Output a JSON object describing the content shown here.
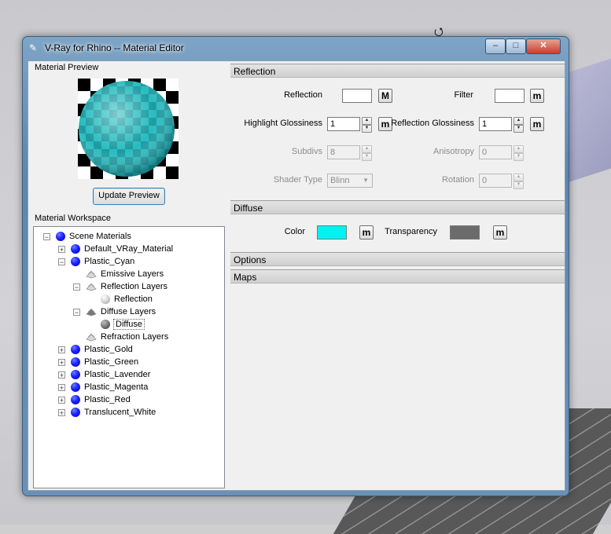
{
  "window": {
    "title": "V-Ray for Rhino -- Material Editor"
  },
  "left": {
    "preview_label": "Material Preview",
    "update_button": "Update Preview",
    "workspace_label": "Material Workspace",
    "tree": [
      {
        "label": "Scene Materials",
        "level": 0,
        "expander": "−",
        "icon": "blue-ball"
      },
      {
        "label": "Default_VRay_Material",
        "level": 1,
        "expander": "+",
        "icon": "blue-ball"
      },
      {
        "label": "Plastic_Cyan",
        "level": 1,
        "expander": "−",
        "icon": "blue-ball"
      },
      {
        "label": "Emissive Layers",
        "level": 2,
        "expander": "",
        "icon": "layer-empty"
      },
      {
        "label": "Reflection Layers",
        "level": 2,
        "expander": "−",
        "icon": "layer-empty"
      },
      {
        "label": "Reflection",
        "level": 3,
        "expander": "",
        "icon": "grey-ball"
      },
      {
        "label": "Diffuse Layers",
        "level": 2,
        "expander": "−",
        "icon": "layer-filled"
      },
      {
        "label": "Diffuse",
        "level": 3,
        "expander": "",
        "icon": "dark-ball",
        "selected": true
      },
      {
        "label": "Refraction Layers",
        "level": 2,
        "expander": "",
        "icon": "layer-empty"
      },
      {
        "label": "Plastic_Gold",
        "level": 1,
        "expander": "+",
        "icon": "blue-ball"
      },
      {
        "label": "Plastic_Green",
        "level": 1,
        "expander": "+",
        "icon": "blue-ball"
      },
      {
        "label": "Plastic_Lavender",
        "level": 1,
        "expander": "+",
        "icon": "blue-ball"
      },
      {
        "label": "Plastic_Magenta",
        "level": 1,
        "expander": "+",
        "icon": "blue-ball"
      },
      {
        "label": "Plastic_Red",
        "level": 1,
        "expander": "+",
        "icon": "blue-ball"
      },
      {
        "label": "Translucent_White",
        "level": 1,
        "expander": "+",
        "icon": "blue-ball"
      }
    ]
  },
  "reflection": {
    "header": "Reflection",
    "reflection_label": "Reflection",
    "filter_label": "Filter",
    "M_btn": "M",
    "m_btn": "m",
    "hl_gloss_label": "Highlight Glossiness",
    "hl_gloss_value": "1",
    "refl_gloss_label": "Reflection Glossiness",
    "refl_gloss_value": "1",
    "subdivs_label": "Subdivs",
    "subdivs_value": "8",
    "aniso_label": "Anisotropy",
    "aniso_value": "0",
    "shader_label": "Shader Type",
    "shader_value": "Blinn",
    "rotation_label": "Rotation",
    "rotation_value": "0",
    "reflection_color": "#ffffff",
    "filter_color": "#ffffff"
  },
  "diffuse": {
    "header": "Diffuse",
    "color_label": "Color",
    "transparency_label": "Transparency",
    "color_value": "#00f2f2",
    "transparency_value": "#6b6b6b",
    "m_btn": "m"
  },
  "options": {
    "header": "Options"
  },
  "maps": {
    "header": "Maps"
  }
}
